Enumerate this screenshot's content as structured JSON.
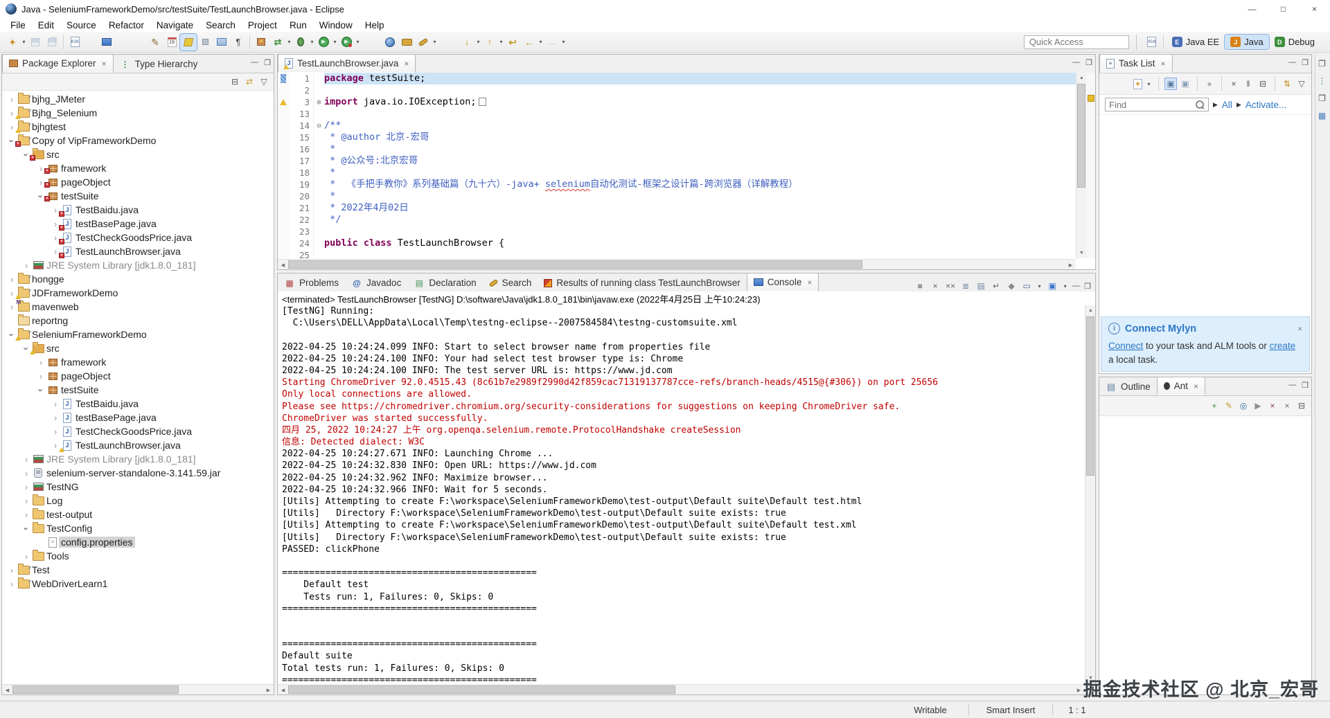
{
  "window": {
    "title": "Java - SeleniumFrameworkDemo/src/testSuite/TestLaunchBrowser.java - Eclipse",
    "controls": [
      "—",
      "□",
      "×"
    ]
  },
  "menus": [
    "File",
    "Edit",
    "Source",
    "Refactor",
    "Navigate",
    "Search",
    "Project",
    "Run",
    "Window",
    "Help"
  ],
  "toolbar": {
    "main": [
      {
        "name": "new-wizard-icon",
        "kind": "new",
        "dd": true
      },
      {
        "name": "save-icon",
        "kind": "floppy",
        "dis": true
      },
      {
        "name": "save-all-icon",
        "kind": "floppyall",
        "dis": true
      },
      {
        "sep": true
      },
      {
        "name": "class-file-icon",
        "kind": "b010"
      },
      {
        "gap": 22
      },
      {
        "name": "open-console-icon",
        "kind": "consoleblue"
      },
      {
        "gap": 46
      },
      {
        "name": "annotate-icon",
        "kind": "pencil"
      },
      {
        "name": "history-icon",
        "kind": "b19"
      },
      {
        "name": "mark-occurrences-icon",
        "kind": "marker",
        "sel": true
      },
      {
        "name": "tool-icon",
        "kind": "smallgray"
      },
      {
        "name": "show-table-icon",
        "kind": "table"
      },
      {
        "name": "show-whitespace-icon",
        "kind": "pilcrow"
      },
      {
        "sep": true
      },
      {
        "name": "new-package-icon",
        "kind": "pkgplus"
      },
      {
        "name": "synchronize-icon",
        "kind": "sync",
        "dd": true
      },
      {
        "name": "debug-icon",
        "kind": "bug",
        "dd": true
      },
      {
        "name": "run-icon",
        "kind": "run",
        "dd": true
      },
      {
        "name": "run-external-icon",
        "kind": "runext",
        "dd": true
      },
      {
        "gap": 30
      },
      {
        "name": "open-type-icon",
        "kind": "orb"
      },
      {
        "name": "search-case-icon",
        "kind": "case"
      },
      {
        "name": "search-icon",
        "kind": "searchpen",
        "dd": true
      },
      {
        "gap": 30
      },
      {
        "name": "next-annotation-icon",
        "kind": "downbar",
        "dd": true
      },
      {
        "name": "prev-annotation-icon",
        "kind": "upbar",
        "dd": true
      },
      {
        "name": "last-edit-location-icon",
        "kind": "backyellow"
      },
      {
        "name": "back-icon",
        "kind": "backarrow",
        "dd": true
      },
      {
        "name": "forward-icon",
        "kind": "fwdarrow",
        "dd": true,
        "dis": true
      }
    ],
    "quick_access": "Quick Access",
    "perspectives": [
      {
        "label": "Java EE",
        "icon": "java-ee-icon"
      },
      {
        "label": "Java",
        "icon": "java-icon",
        "active": true
      },
      {
        "label": "Debug",
        "icon": "debug-persp-icon"
      }
    ]
  },
  "explorer": {
    "tabs": [
      {
        "label": "Package Explorer",
        "icon": "pkgexp",
        "active": true,
        "close": "×"
      },
      {
        "label": "Type Hierarchy",
        "icon": "typehier"
      }
    ],
    "toolbar": [
      {
        "name": "collapse-all-icon",
        "ch": "⊟",
        "fg": "#555"
      },
      {
        "name": "link-with-editor-icon",
        "ch": "⇄",
        "fg": "#c89a2e"
      },
      {
        "name": "view-menu-icon",
        "ch": "▽",
        "fg": "#555"
      }
    ],
    "tree": [
      {
        "i": 0,
        "e": "c",
        "k": "prj",
        "t": "bjhg_JMeter"
      },
      {
        "i": 0,
        "e": "c",
        "k": "prj",
        "b": "w",
        "t": "Bjhg_Selenium"
      },
      {
        "i": 0,
        "e": "c",
        "k": "prj",
        "b": "w",
        "t": "bjhgtest"
      },
      {
        "i": 0,
        "e": "o",
        "k": "prj",
        "b": "e",
        "t": "Copy of VipFrameworkDemo"
      },
      {
        "i": 1,
        "e": "o",
        "k": "src",
        "b": "e",
        "t": "src"
      },
      {
        "i": 2,
        "e": "c",
        "k": "pkg",
        "b": "e",
        "t": "framework"
      },
      {
        "i": 2,
        "e": "c",
        "k": "pkg",
        "b": "e",
        "t": "pageObject"
      },
      {
        "i": 2,
        "e": "o",
        "k": "pkg",
        "b": "e",
        "t": "testSuite"
      },
      {
        "i": 3,
        "e": "c",
        "k": "jav",
        "b": "e",
        "t": "TestBaidu.java"
      },
      {
        "i": 3,
        "e": "c",
        "k": "jav",
        "b": "e",
        "t": "testBasePage.java"
      },
      {
        "i": 3,
        "e": "c",
        "k": "jav",
        "b": "e",
        "t": "TestCheckGoodsPrice.java"
      },
      {
        "i": 3,
        "e": "c",
        "k": "jav",
        "b": "e",
        "t": "TestLaunchBrowser.java"
      },
      {
        "i": 1,
        "e": "c",
        "k": "lib",
        "t": "JRE System Library [jdk1.8.0_181]",
        "dim": true
      },
      {
        "i": 0,
        "e": "c",
        "k": "prj",
        "t": "hongge"
      },
      {
        "i": 0,
        "e": "c",
        "k": "prj",
        "b": "w",
        "t": "JDFrameworkDemo"
      },
      {
        "i": 0,
        "e": "c",
        "k": "mvn",
        "t": "mavenweb"
      },
      {
        "i": 0,
        "e": "n",
        "k": "pfo",
        "t": "reportng"
      },
      {
        "i": 0,
        "e": "o",
        "k": "prj",
        "b": "w",
        "t": "SeleniumFrameworkDemo"
      },
      {
        "i": 1,
        "e": "o",
        "k": "src",
        "b": "w",
        "t": "src"
      },
      {
        "i": 2,
        "e": "c",
        "k": "pkg",
        "t": "framework"
      },
      {
        "i": 2,
        "e": "c",
        "k": "pkg",
        "t": "pageObject"
      },
      {
        "i": 2,
        "e": "o",
        "k": "pkg",
        "t": "testSuite"
      },
      {
        "i": 3,
        "e": "c",
        "k": "jav",
        "t": "TestBaidu.java"
      },
      {
        "i": 3,
        "e": "c",
        "k": "jav",
        "t": "testBasePage.java"
      },
      {
        "i": 3,
        "e": "c",
        "k": "jav",
        "t": "TestCheckGoodsPrice.java"
      },
      {
        "i": 3,
        "e": "c",
        "k": "jav",
        "b": "w",
        "t": "TestLaunchBrowser.java"
      },
      {
        "i": 1,
        "e": "c",
        "k": "lib",
        "t": "JRE System Library [jdk1.8.0_181]",
        "dim": true
      },
      {
        "i": 1,
        "e": "c",
        "k": "jar",
        "t": "selenium-server-standalone-3.141.59.jar"
      },
      {
        "i": 1,
        "e": "c",
        "k": "lib",
        "t": "TestNG"
      },
      {
        "i": 1,
        "e": "c",
        "k": "fol",
        "t": "Log"
      },
      {
        "i": 1,
        "e": "c",
        "k": "fol",
        "t": "test-output"
      },
      {
        "i": 1,
        "e": "o",
        "k": "fol",
        "t": "TestConfig"
      },
      {
        "i": 2,
        "e": "n",
        "k": "file",
        "t": "config.properties",
        "sel": true
      },
      {
        "i": 1,
        "e": "c",
        "k": "fol",
        "t": "Tools"
      },
      {
        "i": 0,
        "e": "c",
        "k": "prj",
        "t": "Test"
      },
      {
        "i": 0,
        "e": "c",
        "k": "prj",
        "t": "WebDriverLearn1"
      }
    ]
  },
  "editor": {
    "tab": {
      "label": "TestLaunchBrowser.java",
      "close": "×"
    },
    "lines": [
      {
        "n": "1",
        "hl": true,
        "m": "blue",
        "segs": [
          [
            "kw",
            "package"
          ],
          [
            "pl",
            " testSuite;"
          ]
        ]
      },
      {
        "n": "2",
        "segs": []
      },
      {
        "n": "3",
        "m": "warn",
        "f": "+",
        "segs": [
          [
            "kw",
            "import"
          ],
          [
            "pl",
            " java.io.IOException;"
          ],
          [
            "box",
            ""
          ]
        ]
      },
      {
        "n": "13",
        "segs": []
      },
      {
        "n": "14",
        "f": "-",
        "segs": [
          [
            "cm",
            "/**"
          ]
        ]
      },
      {
        "n": "15",
        "segs": [
          [
            "cm",
            " * @author 北京-宏哥"
          ]
        ]
      },
      {
        "n": "16",
        "segs": [
          [
            "cm",
            " *"
          ]
        ]
      },
      {
        "n": "17",
        "segs": [
          [
            "cm",
            " * @公众号:北京宏哥"
          ]
        ]
      },
      {
        "n": "18",
        "segs": [
          [
            "cm",
            " *"
          ]
        ]
      },
      {
        "n": "19",
        "segs": [
          [
            "cm",
            " *  《手把手教你》系列基础篇（九十六）-java+ "
          ],
          [
            "cmw",
            "selenium"
          ],
          [
            "cm",
            "自动化测试-框架之设计篇-跨浏览器（详解教程）"
          ]
        ]
      },
      {
        "n": "20",
        "segs": [
          [
            "cm",
            " *"
          ]
        ]
      },
      {
        "n": "21",
        "segs": [
          [
            "cm",
            " * 2022年4月02日"
          ]
        ]
      },
      {
        "n": "22",
        "segs": [
          [
            "cm",
            " */"
          ]
        ]
      },
      {
        "n": "23",
        "segs": []
      },
      {
        "n": "24",
        "segs": [
          [
            "kw",
            "public"
          ],
          [
            "pl",
            " "
          ],
          [
            "kw",
            "class"
          ],
          [
            "pl",
            " TestLaunchBrowser {"
          ]
        ]
      },
      {
        "n": "25",
        "segs": []
      }
    ]
  },
  "console": {
    "tabs": [
      {
        "label": "Problems",
        "icon": "probtab"
      },
      {
        "label": "Javadoc",
        "icon": "attab"
      },
      {
        "label": "Declaration",
        "icon": "decltab"
      },
      {
        "label": "Search",
        "icon": "searchtab"
      },
      {
        "label": "Results of running class TestLaunchBrowser",
        "icon": "testngtab"
      },
      {
        "label": "Console",
        "icon": "consoletab",
        "active": true,
        "close": "×"
      }
    ],
    "toolbar": [
      {
        "name": "terminate-icon",
        "ch": "■",
        "fg": "#9a9a9a"
      },
      {
        "name": "remove-launch-icon",
        "ch": "×",
        "fg": "#666"
      },
      {
        "name": "remove-all-launches-icon",
        "ch": "××",
        "fg": "#666"
      },
      {
        "name": "clear-console-icon",
        "ch": "≣",
        "fg": "#6f88a8"
      },
      {
        "name": "scroll-lock-icon",
        "ch": "▤",
        "fg": "#6f88a8"
      },
      {
        "name": "word-wrap-icon",
        "ch": "↵",
        "fg": "#666"
      },
      {
        "name": "pin-console-icon",
        "ch": "◆",
        "fg": "#8a8a8a"
      },
      {
        "name": "display-selected-console-icon",
        "ch": "▭",
        "fg": "#4a6fa5",
        "dd": true
      },
      {
        "name": "open-console-icon",
        "ch": "▣",
        "fg": "#3b74c8",
        "dd": true
      }
    ],
    "status": "<terminated> TestLaunchBrowser [TestNG] D:\\software\\Java\\jdk1.8.0_181\\bin\\javaw.exe (2022年4月25日 上午10:24:23)",
    "lines": [
      {
        "t": "[TestNG] Running:"
      },
      {
        "t": "  C:\\Users\\DELL\\AppData\\Local\\Temp\\testng-eclipse--2007584584\\testng-customsuite.xml"
      },
      {
        "t": ""
      },
      {
        "t": "2022-04-25 10:24:24.099 INFO: Start to select browser name from properties file"
      },
      {
        "t": "2022-04-25 10:24:24.100 INFO: Your had select test browser type is: Chrome"
      },
      {
        "t": "2022-04-25 10:24:24.100 INFO: The test server URL is: https://www.jd.com"
      },
      {
        "t": "Starting ChromeDriver 92.0.4515.43 (8c61b7e2989f2990d42f859cac71319137787cce-refs/branch-heads/4515@{#306}) on port 25656",
        "c": "r"
      },
      {
        "t": "Only local connections are allowed.",
        "c": "r"
      },
      {
        "t": "Please see https://chromedriver.chromium.org/security-considerations for suggestions on keeping ChromeDriver safe.",
        "c": "r"
      },
      {
        "t": "ChromeDriver was started successfully.",
        "c": "r"
      },
      {
        "t": "四月 25, 2022 10:24:27 上午 org.openqa.selenium.remote.ProtocolHandshake createSession",
        "c": "r"
      },
      {
        "t": "信息: Detected dialect: W3C",
        "c": "r"
      },
      {
        "t": "2022-04-25 10:24:27.671 INFO: Launching Chrome ..."
      },
      {
        "t": "2022-04-25 10:24:32.830 INFO: Open URL: https://www.jd.com"
      },
      {
        "t": "2022-04-25 10:24:32.962 INFO: Maximize browser..."
      },
      {
        "t": "2022-04-25 10:24:32.966 INFO: Wait for 5 seconds."
      },
      {
        "t": "[Utils] Attempting to create F:\\workspace\\SeleniumFrameworkDemo\\test-output\\Default suite\\Default test.html"
      },
      {
        "t": "[Utils]   Directory F:\\workspace\\SeleniumFrameworkDemo\\test-output\\Default suite exists: true"
      },
      {
        "t": "[Utils] Attempting to create F:\\workspace\\SeleniumFrameworkDemo\\test-output\\Default suite\\Default test.xml"
      },
      {
        "t": "[Utils]   Directory F:\\workspace\\SeleniumFrameworkDemo\\test-output\\Default suite exists: true"
      },
      {
        "t": "PASSED: clickPhone"
      },
      {
        "t": ""
      },
      {
        "t": "==============================================="
      },
      {
        "t": "    Default test"
      },
      {
        "t": "    Tests run: 1, Failures: 0, Skips: 0"
      },
      {
        "t": "==============================================="
      },
      {
        "t": ""
      },
      {
        "t": ""
      },
      {
        "t": "==============================================="
      },
      {
        "t": "Default suite"
      },
      {
        "t": "Total tests run: 1, Failures: 0, Skips: 0"
      },
      {
        "t": "==============================================="
      }
    ]
  },
  "tasklist": {
    "tab": {
      "label": "Task List",
      "icon": "tasktab",
      "close": "×"
    },
    "toolbar": [
      {
        "name": "new-task-icon",
        "ch": "+",
        "fg": "#c98f1d",
        "boxed": true,
        "dd": true
      },
      {
        "sep": true
      },
      {
        "name": "categorized-view-icon",
        "ch": "▣",
        "fg": "#5b7ca3",
        "sel": true
      },
      {
        "name": "scheduled-view-icon",
        "ch": "▣",
        "fg": "#8aa0b8"
      },
      {
        "sep": true
      },
      {
        "name": "focus-workweek-icon",
        "ch": "●",
        "fg": "#b0b0b0"
      },
      {
        "sep": true
      },
      {
        "name": "clear-filter-icon",
        "ch": "×",
        "fg": "#555"
      },
      {
        "name": "filter-people-icon",
        "ch": "‖",
        "fg": "#555"
      },
      {
        "name": "collapse-all-icon",
        "ch": "⊟",
        "fg": "#555"
      },
      {
        "sep": true
      },
      {
        "name": "synchronize-db-icon",
        "ch": "⇅",
        "fg": "#c98f1d"
      },
      {
        "name": "view-menu-icon",
        "ch": "▽",
        "fg": "#555"
      }
    ],
    "find": {
      "placeholder": "Find",
      "all_label": "All",
      "activate_label": "Activate..."
    }
  },
  "mylyn": {
    "title": "Connect Mylyn",
    "close": "×",
    "body": [
      [
        "link",
        "Connect"
      ],
      [
        "t",
        " to your task and ALM tools or "
      ],
      [
        "link",
        "create"
      ],
      [
        "t",
        " a local task."
      ]
    ]
  },
  "outline_ant": {
    "tabs": [
      {
        "label": "Outline",
        "icon": "outlinetab"
      },
      {
        "label": "Ant",
        "icon": "anttab",
        "active": true,
        "close": "×"
      }
    ],
    "toolbar": [
      {
        "name": "add-buildfile-icon",
        "ch": "+",
        "fg": "#2e8b2e"
      },
      {
        "name": "search-buildfile-icon",
        "ch": "✎",
        "fg": "#c89a2e"
      },
      {
        "name": "filter-internal-targets-icon",
        "ch": "◎",
        "fg": "#3568a8"
      },
      {
        "name": "run-default-target-icon",
        "ch": "▶",
        "fg": "#8f8f8f"
      },
      {
        "name": "remove-buildfile-icon",
        "ch": "×",
        "fg": "#8f4040"
      },
      {
        "name": "remove-all-buildfiles-icon",
        "ch": "×",
        "fg": "#6f6f6f"
      },
      {
        "name": "collapse-all-icon",
        "ch": "⊟",
        "fg": "#555"
      }
    ]
  },
  "edgestrip": [
    {
      "name": "restore-view-icon",
      "ch": "❐",
      "fg": "#555"
    },
    {
      "name": "minimized-hierarchy-view-icon",
      "ch": "⋮",
      "fg": "#3e8f3e"
    },
    {
      "name": "restore-view-icon-2",
      "ch": "❐",
      "fg": "#555"
    },
    {
      "name": "minimized-table-view-icon",
      "ch": "▦",
      "fg": "#4a7ebb"
    }
  ],
  "statusbar": {
    "writable": "Writable",
    "smart_insert": "Smart Insert",
    "caret": "1 : 1",
    "watermark": "掘金技术社区 @ 北京_宏哥"
  },
  "colors": {
    "accent_selection": "#cde4f7",
    "keyword": "#7f0055",
    "comment": "#3f5fbf",
    "console_error": "#c00000",
    "link": "#2b77c5"
  }
}
